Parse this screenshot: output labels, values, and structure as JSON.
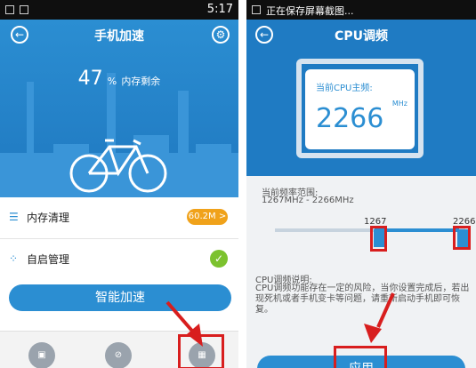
{
  "left": {
    "status": {
      "time": "5:17"
    },
    "header": {
      "title": "手机加速"
    },
    "memory": {
      "percent": "47",
      "unit": "%",
      "label": "内存剩余"
    },
    "rows": [
      {
        "label": "内存清理",
        "badge": "60.2M >"
      },
      {
        "label": "自启管理"
      }
    ],
    "main_button": "智能加速"
  },
  "right": {
    "status": {
      "message": "正在保存屏幕截图..."
    },
    "header": {
      "title": "CPU调频"
    },
    "current": {
      "caption": "当前CPU主频:",
      "value": "2266",
      "unit": "MHz"
    },
    "range": {
      "label": "当前频率范围:",
      "value": "1267MHz - 2266MHz",
      "min": "1267",
      "max": "2266"
    },
    "description": {
      "title": "CPU调频说明:",
      "text": "CPU调频功能存在一定的风险，当你设置完成后，若出现死机或者手机变卡等问题，请重新启动手机即可恢复。"
    },
    "apply_button": "应用"
  },
  "colors": {
    "accent": "#2b8ed2",
    "badge": "#f0a21a",
    "check": "#7cc22e",
    "highlight": "#d81e1e"
  }
}
